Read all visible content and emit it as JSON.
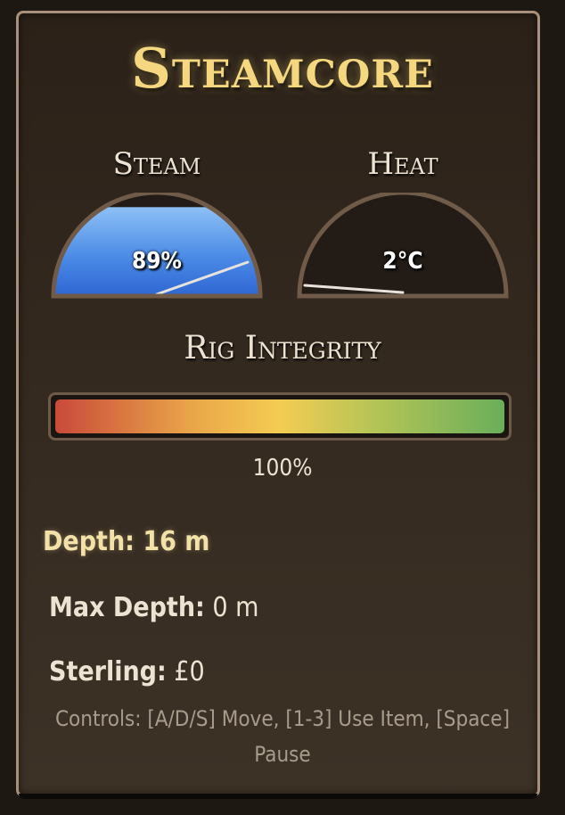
{
  "game": {
    "title": "Steamcore"
  },
  "gauges": {
    "steam": {
      "label": "Steam",
      "value_text": "89%",
      "level": 0.89,
      "fill_color": "#3d7fe6"
    },
    "heat": {
      "label": "Heat",
      "value_text": "2°C",
      "level": 0.02,
      "fill_color": "#e2732e"
    }
  },
  "integrity": {
    "label": "Rig Integrity",
    "value_text": "100%",
    "level": 1.0
  },
  "stats": {
    "depth": {
      "label": "Depth:",
      "value": "16 m"
    },
    "max_depth": {
      "label": "Max Depth:",
      "value": "0 m"
    },
    "sterling": {
      "label": "Sterling:",
      "value": "£0"
    }
  },
  "controls": {
    "text": "Controls: [A/D/S] Move, [1-3] Use Item, [Space] Pause"
  },
  "colors": {
    "title_gold": "#f4d77f",
    "panel_border": "#a8907a",
    "gauge_rim": "#705a48"
  }
}
